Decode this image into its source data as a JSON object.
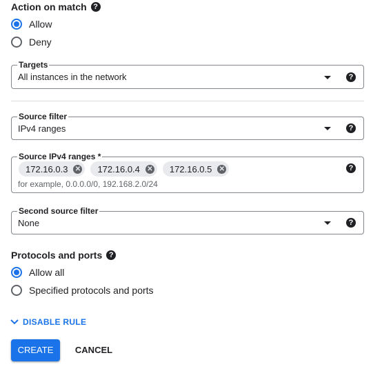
{
  "action": {
    "title": "Action on match",
    "options": [
      {
        "label": "Allow",
        "checked": true
      },
      {
        "label": "Deny",
        "checked": false
      }
    ]
  },
  "targets": {
    "label": "Targets",
    "value": "All instances in the network"
  },
  "source_filter": {
    "label": "Source filter",
    "value": "IPv4 ranges"
  },
  "source_ranges": {
    "label": "Source IPv4 ranges *",
    "chips": [
      "172.16.0.3",
      "172.16.0.4",
      "172.16.0.5"
    ],
    "placeholder": "for example, 0.0.0.0/0, 192.168.2.0/24"
  },
  "second_filter": {
    "label": "Second source filter",
    "value": "None"
  },
  "protocols": {
    "title": "Protocols and ports",
    "options": [
      {
        "label": "Allow all",
        "checked": true
      },
      {
        "label": "Specified protocols and ports",
        "checked": false
      }
    ]
  },
  "disable_rule": {
    "label": "DISABLE RULE"
  },
  "buttons": {
    "create": "CREATE",
    "cancel": "CANCEL"
  },
  "colors": {
    "accent": "#1a73e8",
    "border": "#80868b",
    "text": "#202124"
  }
}
